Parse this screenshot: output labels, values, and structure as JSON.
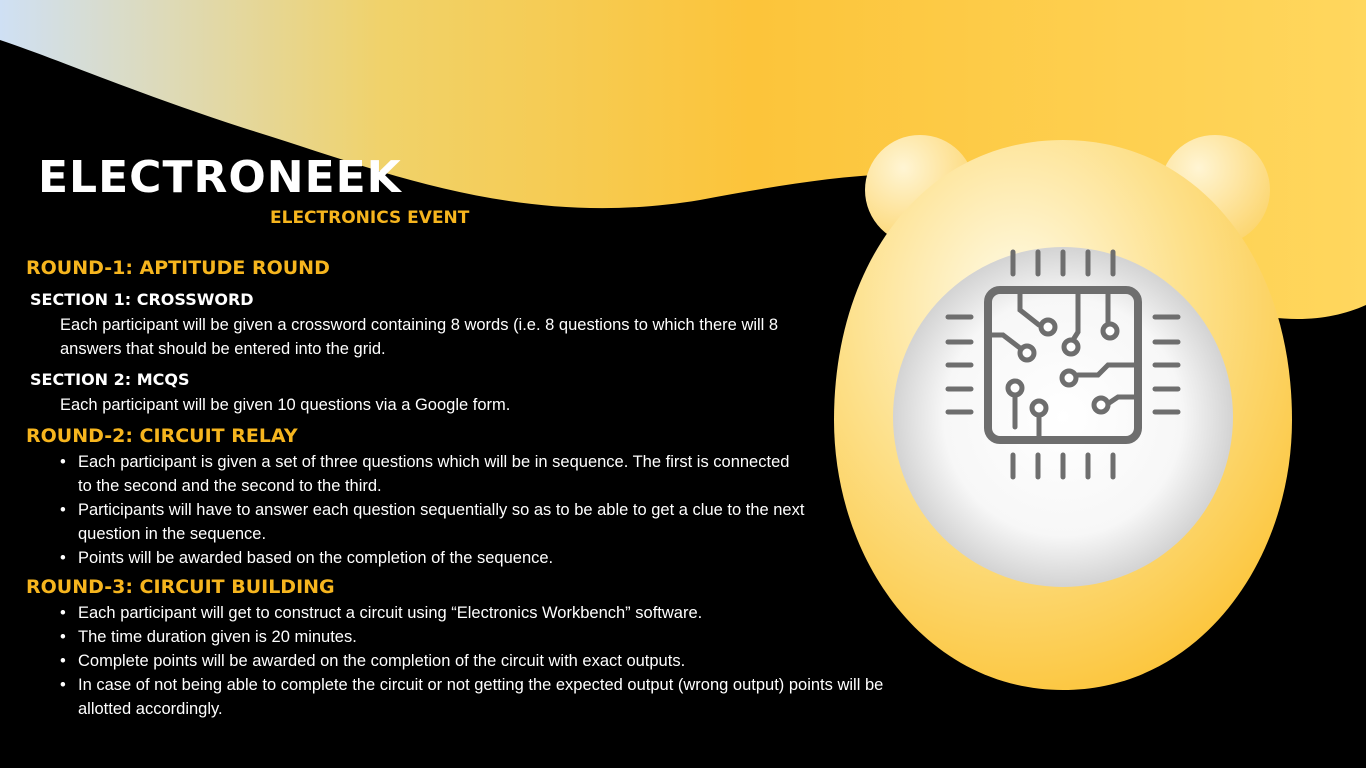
{
  "header": {
    "title": "ELECTRONEEK",
    "subtitle": "ELECTRONICS EVENT"
  },
  "colors": {
    "accent": "#f6b51e",
    "background": "#000000",
    "yellow": "#fcc72f",
    "icon": "#6e6e6e"
  },
  "icon": "circuit-chip-icon",
  "round1": {
    "heading": "ROUND-1: APTITUDE ROUND",
    "section1": {
      "heading": "SECTION 1: CROSSWORD",
      "text": "Each participant will be given a crossword containing 8 words (i.e. 8 questions to which there will 8 answers that should be entered into the grid."
    },
    "section2": {
      "heading": "SECTION 2: MCQS",
      "text": "Each participant will be given 10 questions via a Google form."
    }
  },
  "round2": {
    "heading": "ROUND-2: CIRCUIT RELAY",
    "bullets": [
      "Each participant is given a set of three questions which will be in sequence. The first is connected to the second and the second to the third.",
      "Participants will have to answer each question sequentially so as to be able to get a clue to the next question in the sequence.",
      "Points will be awarded based on the completion of the sequence."
    ]
  },
  "round3": {
    "heading": "ROUND-3: CIRCUIT BUILDING",
    "bullets": [
      "Each participant will get to construct a circuit using “Electronics Workbench” software.",
      "The time duration given is 20 minutes.",
      "Complete points will be awarded on the completion of the circuit with exact outputs.",
      "In case of not being able to complete the circuit or not getting the expected output (wrong output) points will be allotted accordingly."
    ]
  }
}
